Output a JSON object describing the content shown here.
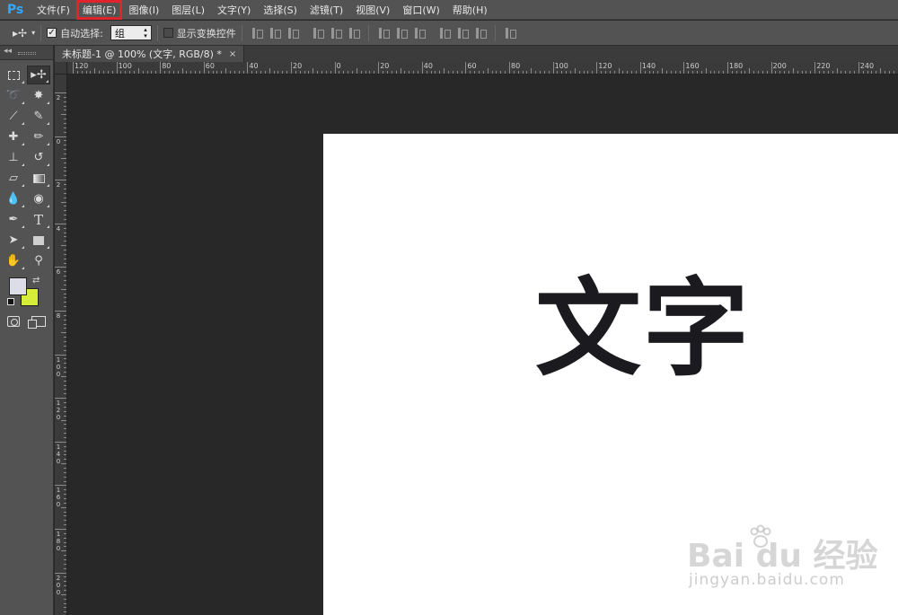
{
  "app": {
    "logo": "Ps",
    "menu": [
      {
        "label": "文件(F)",
        "highlighted": false
      },
      {
        "label": "编辑(E)",
        "highlighted": true
      },
      {
        "label": "图像(I)",
        "highlighted": false
      },
      {
        "label": "图层(L)",
        "highlighted": false
      },
      {
        "label": "文字(Y)",
        "highlighted": false
      },
      {
        "label": "选择(S)",
        "highlighted": false
      },
      {
        "label": "滤镜(T)",
        "highlighted": false
      },
      {
        "label": "视图(V)",
        "highlighted": false
      },
      {
        "label": "窗口(W)",
        "highlighted": false
      },
      {
        "label": "帮助(H)",
        "highlighted": false
      }
    ],
    "annotation_color": "#e0242e"
  },
  "options": {
    "move_tool_icon": "move-arrow-icon",
    "auto_select_label": "自动选择:",
    "auto_select_checked": true,
    "auto_select_value": "组",
    "show_transform_label": "显示变换控件",
    "show_transform_checked": false
  },
  "document": {
    "tab_title": "未标题-1 @ 100% (文字, RGB/8) *",
    "close_glyph": "×",
    "canvas_text": "文字",
    "canvas_text_color": "#1b1a1f"
  },
  "rulers": {
    "horizontal": [
      "120",
      "100",
      "80",
      "60",
      "40",
      "20",
      "0",
      "20",
      "40",
      "60",
      "80",
      "100",
      "120",
      "140",
      "160",
      "180",
      "200",
      "220",
      "240"
    ],
    "vertical": [
      "2",
      "0",
      "2",
      "4",
      "6",
      "8",
      "100",
      "120",
      "140",
      "160",
      "180",
      "200"
    ]
  },
  "colors": {
    "foreground": "#dcdde6",
    "background": "#d6ed3a"
  },
  "watermark": {
    "brand": "Bai  du 经验",
    "url": "jingyan.baidu.com"
  }
}
